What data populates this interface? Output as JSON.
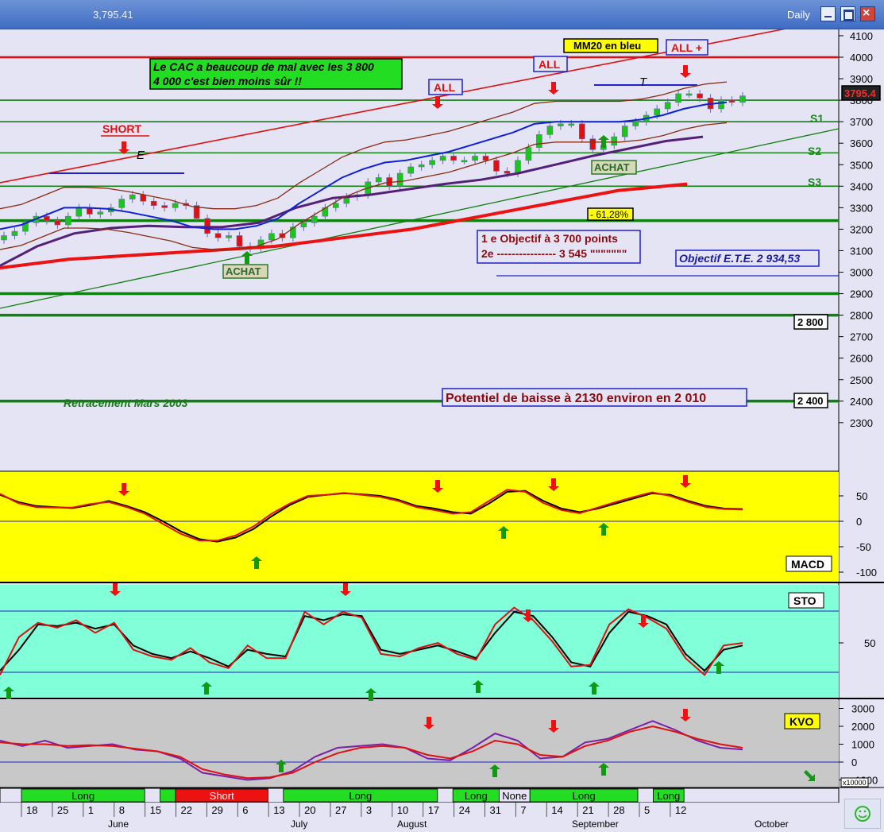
{
  "window": {
    "price": "3,795.41",
    "period": "Daily"
  },
  "annotations": {
    "cac_note_line1": "Le CAC a beaucoup de mal avec les 3 800",
    "cac_note_line2": "4 000 c'est bien moins sûr !!",
    "mm20": "MM20 en bleu",
    "all_1": "ALL",
    "all_2": "ALL",
    "all_plus": "ALL +",
    "short": "SHORT",
    "achat_1": "ACHAT",
    "achat_2": "ACHAT",
    "fib": "- 61,28%",
    "objectif_1": "1 e Objectif  à 3 700 points",
    "objectif_2": "2e ---------------- 3 545 \"\"\"\"\"\"\"",
    "objectif_ete": "Objectif E.T.E. 2 934,53",
    "retracement": "Retracement Mars 2003",
    "potentiel": "Potentiel de baisse à 2130 environ en 2 010",
    "label_2800": "2 800",
    "label_2400": "2 400",
    "s1": "S1",
    "s2": "S2",
    "s3": "S3",
    "letter_e": "E",
    "letter_t": "T",
    "current_price": "3795.4"
  },
  "indicators": {
    "macd": "MACD",
    "sto": "STO",
    "kvo": "KVO",
    "kvo_scale": "x10000"
  },
  "icons": {
    "smiley": "smiley-icon",
    "arrow_down": "red-down-arrow-icon",
    "arrow_up": "green-up-arrow-icon"
  },
  "colors": {
    "main_bg": "#e4e4f4",
    "macd_bg": "#ffff00",
    "sto_bg": "#80ffd8",
    "kvo_bg": "#c8c8c8",
    "bull": "#19c719",
    "bear": "#e01010",
    "long": "#22dd22",
    "short": "#ee1111"
  },
  "signals": [
    {
      "label": "Long",
      "start": 1,
      "end": 8,
      "state": "long"
    },
    {
      "label": "",
      "start": 10,
      "end": 10,
      "state": "long"
    },
    {
      "label": "Short",
      "start": 11,
      "end": 16,
      "state": "short"
    },
    {
      "label": "Long",
      "start": 18,
      "end": 27,
      "state": "long"
    },
    {
      "label": "Long",
      "start": 29,
      "end": 31,
      "state": "long"
    },
    {
      "label": "None",
      "start": 32,
      "end": 33,
      "state": "none"
    },
    {
      "label": "Long",
      "start": 34,
      "end": 40,
      "state": "long"
    },
    {
      "label": "Long",
      "start": 42,
      "end": 43,
      "state": "long"
    }
  ],
  "chart_data": [
    {
      "type": "candlestick",
      "title": "",
      "y_ticks": [
        4100,
        4000,
        3900,
        3800,
        3700,
        3600,
        3500,
        3400,
        3300,
        3200,
        3100,
        3000,
        2900,
        2800,
        2700,
        2600,
        2500,
        2400,
        2300
      ],
      "ylim": [
        2200,
        4150
      ],
      "x_tick_labels": [
        "18",
        "25",
        "1",
        "8",
        "15",
        "22",
        "29",
        "6",
        "13",
        "20",
        "27",
        "3",
        "10",
        "17",
        "24",
        "31",
        "7",
        "14",
        "21",
        "28",
        "5",
        "12"
      ],
      "months": [
        "June",
        "July",
        "August",
        "September",
        "October"
      ],
      "horizontal_levels": [
        {
          "value": 4000,
          "color": "#e01010"
        },
        {
          "value": 3800,
          "color": "#108010"
        },
        {
          "value": 3700,
          "color": "#108010"
        },
        {
          "value": 3555,
          "color": "#108010"
        },
        {
          "value": 3400,
          "color": "#108010"
        },
        {
          "value": 3240,
          "color": "#108010"
        },
        {
          "value": 2900,
          "color": "#108010"
        },
        {
          "value": 2800,
          "color": "#108010"
        },
        {
          "value": 2400,
          "color": "#108010"
        }
      ],
      "close": [
        3170,
        3190,
        3230,
        3260,
        3240,
        3220,
        3260,
        3300,
        3270,
        3280,
        3300,
        3340,
        3360,
        3330,
        3310,
        3300,
        3320,
        3310,
        3250,
        3180,
        3160,
        3170,
        3120,
        3110,
        3150,
        3180,
        3160,
        3210,
        3230,
        3260,
        3300,
        3320,
        3350,
        3360,
        3420,
        3440,
        3400,
        3460,
        3490,
        3500,
        3520,
        3540,
        3520,
        3520,
        3540,
        3520,
        3470,
        3460,
        3520,
        3580,
        3640,
        3680,
        3690,
        3690,
        3620,
        3570,
        3590,
        3630,
        3680,
        3700,
        3730,
        3760,
        3790,
        3830,
        3830,
        3810,
        3760,
        3800,
        3790,
        3820
      ],
      "mm20": [
        3200,
        3220,
        3260,
        3300,
        3300,
        3295,
        3280,
        3260,
        3240,
        3210,
        3200,
        3200,
        3215,
        3250,
        3320,
        3380,
        3440,
        3480,
        3510,
        3520,
        3540,
        3560,
        3590,
        3620,
        3650,
        3690,
        3700,
        3700,
        3700,
        3700,
        3710,
        3730,
        3760,
        3780,
        3790
      ],
      "mm_purple": [
        3030,
        3120,
        3180,
        3205,
        3215,
        3210,
        3210,
        3230,
        3300,
        3345,
        3360,
        3385,
        3410,
        3430,
        3460,
        3500,
        3540,
        3575,
        3610,
        3630
      ],
      "mm_red_long": [
        3020,
        3060,
        3080,
        3100,
        3120,
        3160,
        3200,
        3260,
        3320,
        3380,
        3410
      ]
    },
    {
      "type": "line",
      "title": "MACD",
      "y_ticks": [
        50,
        0,
        -50,
        -100
      ],
      "ylim": [
        -110,
        90
      ],
      "series": [
        {
          "color": "#000000",
          "values": [
            52,
            38,
            30,
            28,
            26,
            32,
            40,
            30,
            18,
            0,
            -20,
            -35,
            -40,
            -32,
            -15,
            10,
            32,
            48,
            52,
            55,
            53,
            50,
            42,
            30,
            25,
            18,
            15,
            35,
            58,
            60,
            40,
            25,
            18,
            25,
            35,
            45,
            55,
            52,
            40,
            30,
            25,
            24
          ]
        },
        {
          "color": "#e01010",
          "values": [
            54,
            36,
            28,
            27,
            27,
            34,
            38,
            28,
            15,
            -5,
            -25,
            -38,
            -38,
            -28,
            -10,
            15,
            35,
            50,
            52,
            56,
            52,
            48,
            40,
            28,
            22,
            15,
            18,
            40,
            62,
            58,
            36,
            22,
            16,
            27,
            38,
            48,
            57,
            50,
            38,
            28,
            24,
            23
          ]
        }
      ]
    },
    {
      "type": "line",
      "title": "STO",
      "y_ticks": [
        50
      ],
      "ylim": [
        0,
        100
      ],
      "series": [
        {
          "color": "#000000",
          "values": [
            15,
            40,
            70,
            68,
            72,
            65,
            70,
            45,
            35,
            30,
            38,
            30,
            20,
            40,
            35,
            32,
            80,
            75,
            82,
            80,
            40,
            35,
            40,
            45,
            38,
            30,
            60,
            85,
            80,
            55,
            25,
            20,
            60,
            85,
            80,
            70,
            35,
            15,
            40,
            45
          ]
        },
        {
          "color": "#e01010",
          "values": [
            10,
            55,
            72,
            66,
            75,
            60,
            72,
            40,
            32,
            28,
            42,
            25,
            18,
            45,
            30,
            30,
            85,
            70,
            85,
            78,
            35,
            32,
            42,
            48,
            35,
            28,
            70,
            90,
            75,
            50,
            20,
            22,
            70,
            88,
            78,
            65,
            30,
            10,
            45,
            48
          ]
        }
      ]
    },
    {
      "type": "line",
      "title": "KVO",
      "y_ticks": [
        3000,
        2000,
        1000,
        0,
        -1000
      ],
      "ylim": [
        -1500,
        3400
      ],
      "series": [
        {
          "color": "#7a1fa8",
          "values": [
            1200,
            900,
            1200,
            800,
            900,
            1000,
            700,
            600,
            200,
            -600,
            -800,
            -1000,
            -900,
            -500,
            300,
            800,
            900,
            1000,
            800,
            200,
            100,
            800,
            1600,
            1200,
            200,
            300,
            1100,
            1300,
            1800,
            2300,
            1800,
            1200,
            800,
            700
          ]
        },
        {
          "color": "#e01010",
          "values": [
            1100,
            1000,
            1000,
            900,
            950,
            900,
            750,
            600,
            300,
            -400,
            -700,
            -900,
            -850,
            -600,
            0,
            500,
            800,
            900,
            800,
            400,
            200,
            600,
            1200,
            1000,
            400,
            300,
            900,
            1200,
            1700,
            2000,
            1700,
            1300,
            1000,
            800
          ]
        }
      ]
    }
  ]
}
